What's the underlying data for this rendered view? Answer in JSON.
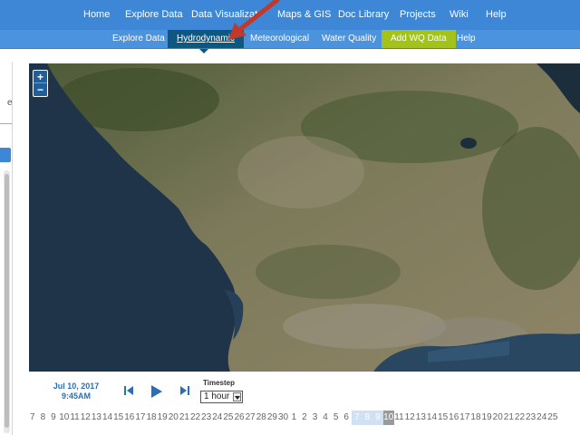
{
  "nav": {
    "items": [
      "Home",
      "Explore Data",
      "Data Visualizations",
      "Maps & GIS",
      "Doc Library",
      "Projects",
      "Wiki",
      "Help"
    ]
  },
  "subnav": {
    "items": [
      "Explore Data",
      "Hydrodynamic",
      "Meteorological",
      "Water Quality",
      "Add WQ Data",
      "Help"
    ],
    "active": "Hydrodynamic"
  },
  "left_panel": {
    "partial_text": "e"
  },
  "map": {
    "zoom_in": "+",
    "zoom_out": "−"
  },
  "controls": {
    "date": "Jul 10, 2017",
    "time": "9:45AM",
    "timestep_label": "Timestep",
    "timestep_value": "1 hour"
  },
  "timeline": {
    "days": [
      "7",
      "8",
      "9",
      "10",
      "11",
      "12",
      "13",
      "14",
      "15",
      "16",
      "17",
      "18",
      "19",
      "20",
      "21",
      "22",
      "23",
      "24",
      "25",
      "26",
      "27",
      "28",
      "29",
      "30",
      "1",
      "2",
      "3",
      "4",
      "5",
      "6",
      "7",
      "8",
      "9",
      "10",
      "11",
      "12",
      "13",
      "14",
      "15",
      "16",
      "17",
      "18",
      "19",
      "20",
      "21",
      "22",
      "23",
      "24",
      "25"
    ],
    "highlighted": [
      "7",
      "8",
      "9"
    ],
    "current": "10"
  },
  "colors": {
    "nav_bg": "#3e86d6",
    "active_tab": "#0d5781",
    "add_wq": "#a3c21b",
    "annotation": "#c0392b"
  }
}
